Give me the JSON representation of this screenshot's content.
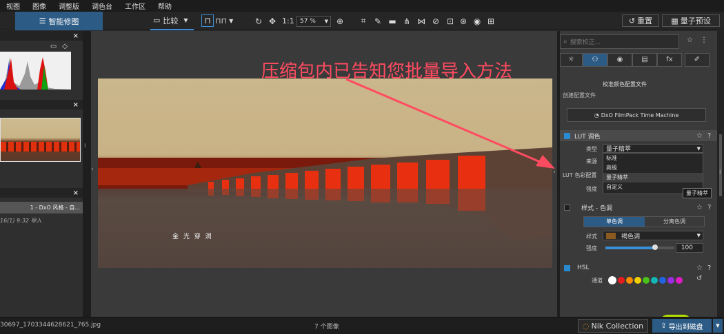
{
  "menu": [
    "视图",
    "图像",
    "调整版",
    "调色台",
    "工作区",
    "帮助"
  ],
  "toolbar": {
    "smart_label": "智能修图",
    "compare_label": "比较",
    "ratio_label": "1:1",
    "zoom_value": "57 %",
    "reset_label": "重置",
    "preset_label": "量子预设"
  },
  "overlay_text": "压缩包内已告知您批量导入方法",
  "image_caption": "金 光 穿 洞",
  "left": {
    "file_label": "1 - DxO 风格 - 自...",
    "file_info": "16(1) 9:32 导入"
  },
  "right": {
    "search_placeholder": "搜索校正...",
    "tabs": [
      "☼",
      "⚇",
      "◉",
      "▤",
      "fx",
      "✐"
    ],
    "section_title": "校准颜色配置文件",
    "create_label": "创建配置文件",
    "filmpack_label": "DxO FilmPack Time Machine",
    "lut": {
      "title": "LUT 调色",
      "type_label": "类型",
      "type_value": "量子精萃",
      "source_label": "来源",
      "profile_label": "LUT 色彩配置",
      "intensity_label": "强度",
      "options": [
        "标准",
        "高级",
        "量子精萃",
        "自定义"
      ],
      "tooltip": "量子精萃"
    },
    "style": {
      "title": "样式 - 色调",
      "tab1": "单色调",
      "tab2": "分离色调",
      "style_label": "样式",
      "style_value": "褐色调",
      "intensity_label": "强度",
      "intensity_value": "100",
      "fraction": 0.72
    },
    "hsl": {
      "title": "HSL",
      "channel_label": "通道",
      "colors": [
        "#ffffff",
        "#e81d1d",
        "#ff8c00",
        "#f2d000",
        "#49c21a",
        "#13b5b5",
        "#2264e0",
        "#9b2ce0",
        "#e01cc4"
      ]
    }
  },
  "status": {
    "filename": "30697_1703344628621_765.jpg",
    "count": "7 个图像",
    "nik_label": "Nik Collection",
    "export_label": "导出到磁盘"
  }
}
